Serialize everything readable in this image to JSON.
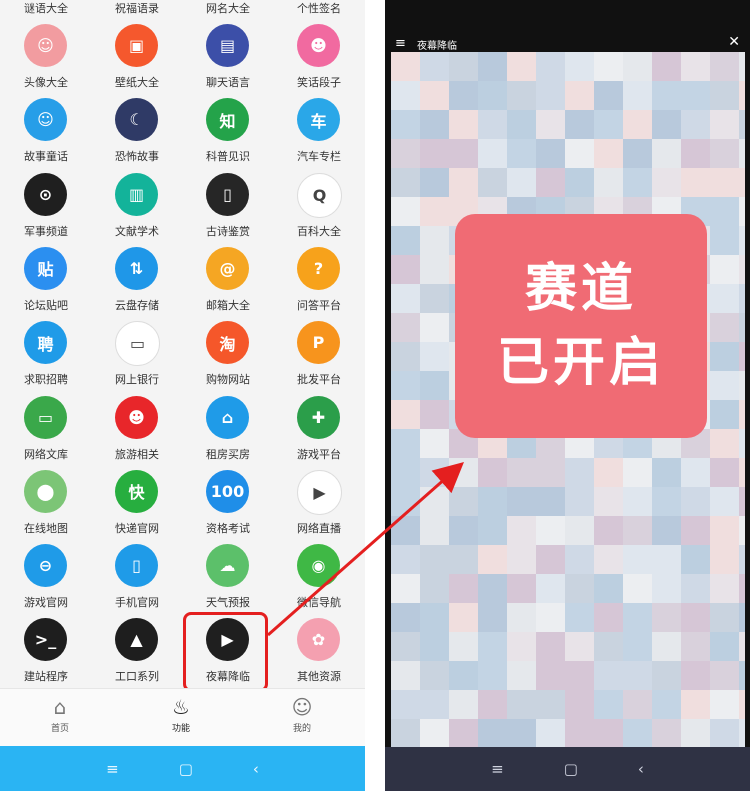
{
  "left": {
    "top_row_labels": [
      "谜语大全",
      "祝福语录",
      "网名大全",
      "个性签名"
    ],
    "grid_rows": [
      [
        {
          "label": "头像大全",
          "icon": "avatar-icon",
          "color": "#f29ca0",
          "glyph": "☺"
        },
        {
          "label": "壁纸大全",
          "icon": "wallpaper-icon",
          "color": "#f5582d",
          "glyph": "▣"
        },
        {
          "label": "聊天语言",
          "icon": "chat-icon",
          "color": "#3c4fa8",
          "glyph": "▤"
        },
        {
          "label": "笑话段子",
          "icon": "monkey-icon",
          "color": "#f16aa0",
          "glyph": "☻"
        }
      ],
      [
        {
          "label": "故事童话",
          "icon": "story-icon",
          "color": "#279ee8",
          "glyph": "☺"
        },
        {
          "label": "恐怖故事",
          "icon": "horror-icon",
          "color": "#2f3a66",
          "glyph": "☾"
        },
        {
          "label": "科普见识",
          "icon": "knowledge-icon",
          "color": "#24a34a",
          "glyph": "知"
        },
        {
          "label": "汽车专栏",
          "icon": "car-icon",
          "color": "#2aa7e8",
          "glyph": "车"
        }
      ],
      [
        {
          "label": "军事频道",
          "icon": "military-icon",
          "color": "#1f1f1f",
          "glyph": "⊙"
        },
        {
          "label": "文献学术",
          "icon": "book-icon",
          "color": "#13b39a",
          "glyph": "▥"
        },
        {
          "label": "古诗鉴赏",
          "icon": "poem-icon",
          "color": "#262626",
          "glyph": "▯"
        },
        {
          "label": "百科大全",
          "icon": "encyclopedia-icon",
          "color": "#ffffff",
          "glyph": "Q"
        }
      ],
      [
        {
          "label": "论坛贴吧",
          "icon": "forum-icon",
          "color": "#2b8ff0",
          "glyph": "贴"
        },
        {
          "label": "云盘存储",
          "icon": "cloud-icon",
          "color": "#1f97e8",
          "glyph": "⇅"
        },
        {
          "label": "邮箱大全",
          "icon": "mail-icon",
          "color": "#f5a623",
          "glyph": "@"
        },
        {
          "label": "问答平台",
          "icon": "question-icon",
          "color": "#f7a21b",
          "glyph": "?"
        }
      ],
      [
        {
          "label": "求职招聘",
          "icon": "job-icon",
          "color": "#1f9be8",
          "glyph": "聘"
        },
        {
          "label": "网上银行",
          "icon": "bank-icon",
          "color": "#ffffff",
          "glyph": "▭"
        },
        {
          "label": "购物网站",
          "icon": "shopping-icon",
          "color": "#f5572a",
          "glyph": "淘"
        },
        {
          "label": "批发平台",
          "icon": "wholesale-icon",
          "color": "#f7941d",
          "glyph": "P"
        }
      ],
      [
        {
          "label": "网络文库",
          "icon": "library-icon",
          "color": "#3aa84a",
          "glyph": "▭"
        },
        {
          "label": "旅游相关",
          "icon": "travel-icon",
          "color": "#e8262a",
          "glyph": "☻"
        },
        {
          "label": "租房买房",
          "icon": "house-icon",
          "color": "#1f9be8",
          "glyph": "⌂"
        },
        {
          "label": "游戏平台",
          "icon": "gamepad-icon",
          "color": "#2b9e4a",
          "glyph": "✚"
        }
      ],
      [
        {
          "label": "在线地图",
          "icon": "map-icon",
          "color": "#7cc576",
          "glyph": "⬤"
        },
        {
          "label": "快递官网",
          "icon": "express-icon",
          "color": "#27ae3f",
          "glyph": "快"
        },
        {
          "label": "资格考试",
          "icon": "exam-icon",
          "color": "#1f8ee8",
          "glyph": "100"
        },
        {
          "label": "网络直播",
          "icon": "live-icon",
          "color": "#ffffff",
          "glyph": "▶"
        }
      ],
      [
        {
          "label": "游戏官网",
          "icon": "game-site-icon",
          "color": "#1f9be8",
          "glyph": "⊖"
        },
        {
          "label": "手机官网",
          "icon": "phone-icon",
          "color": "#1f9be8",
          "glyph": "▯"
        },
        {
          "label": "天气预报",
          "icon": "weather-icon",
          "color": "#5cc06a",
          "glyph": "☁"
        },
        {
          "label": "微信导航",
          "icon": "wechat-icon",
          "color": "#3fb845",
          "glyph": "◉"
        }
      ],
      [
        {
          "label": "建站程序",
          "icon": "terminal-icon",
          "color": "#1e1e1e",
          "glyph": ">_"
        },
        {
          "label": "工口系列",
          "icon": "warning-icon",
          "color": "#1e1e1e",
          "glyph": "▲"
        },
        {
          "label": "夜幕降临",
          "icon": "play-icon",
          "color": "#1f1f1f",
          "glyph": "▶"
        },
        {
          "label": "其他资源",
          "icon": "anime-avatar-icon",
          "color": "#f4a0b0",
          "glyph": "✿"
        }
      ]
    ],
    "tabs": [
      {
        "label": "首页",
        "icon": "home-icon",
        "glyph": "⌂"
      },
      {
        "label": "功能",
        "icon": "flame-icon",
        "glyph": "♨"
      },
      {
        "label": "我的",
        "icon": "user-icon",
        "glyph": "☺"
      }
    ],
    "nav": {
      "menu": "≡",
      "home": "▢",
      "back": "‹"
    }
  },
  "right": {
    "title": "夜幕降临",
    "menu_glyph": "≡",
    "close_glyph": "✕",
    "overlay_line1": "赛道",
    "overlay_line2": "已开启",
    "overlay_color": "#f06b74",
    "nav": {
      "menu": "≡",
      "home": "▢",
      "back": "‹"
    }
  },
  "accent": {
    "blue": "#2ab4f3",
    "highlight_red": "#e41f1f"
  }
}
